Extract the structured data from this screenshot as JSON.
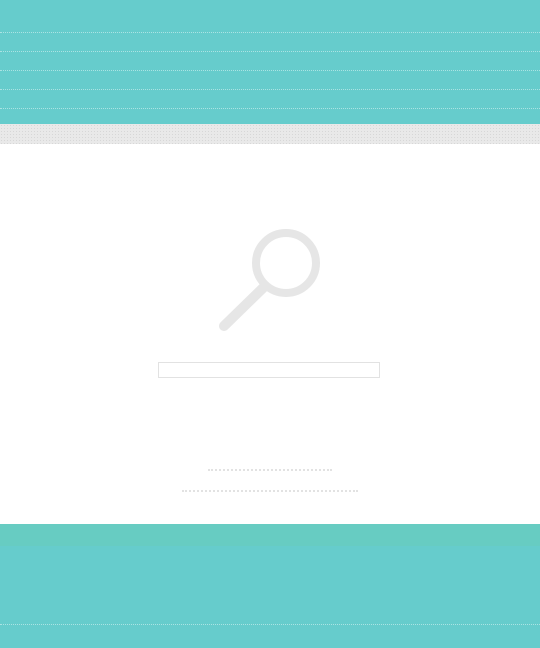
{
  "header": {
    "color": "#66cccc"
  },
  "sub_strip": {
    "color": "#e9e9e9"
  },
  "empty_state": {
    "icon": "search-icon",
    "search_field_value": ""
  },
  "footer": {
    "color": "#66cccc"
  }
}
